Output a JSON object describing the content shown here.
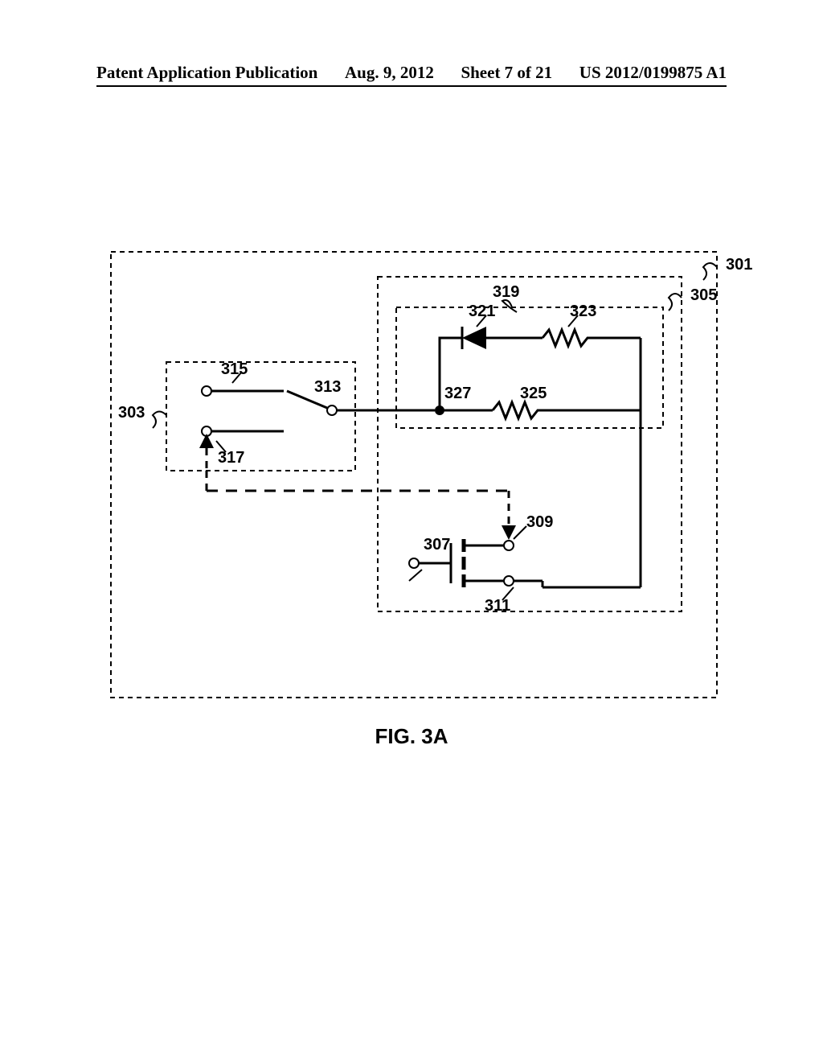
{
  "header": {
    "title": "Patent Application Publication",
    "date": "Aug. 9, 2012",
    "sheet": "Sheet 7 of 21",
    "pubnum": "US 2012/0199875 A1"
  },
  "figure": {
    "caption": "FIG. 3A"
  },
  "labels": {
    "l301": "301",
    "l303": "303",
    "l305": "305",
    "l307": "307",
    "l309": "309",
    "l311": "311",
    "l313": "313",
    "l315": "315",
    "l317": "317",
    "l319": "319",
    "l321": "321",
    "l323": "323",
    "l325": "325",
    "l327": "327"
  }
}
